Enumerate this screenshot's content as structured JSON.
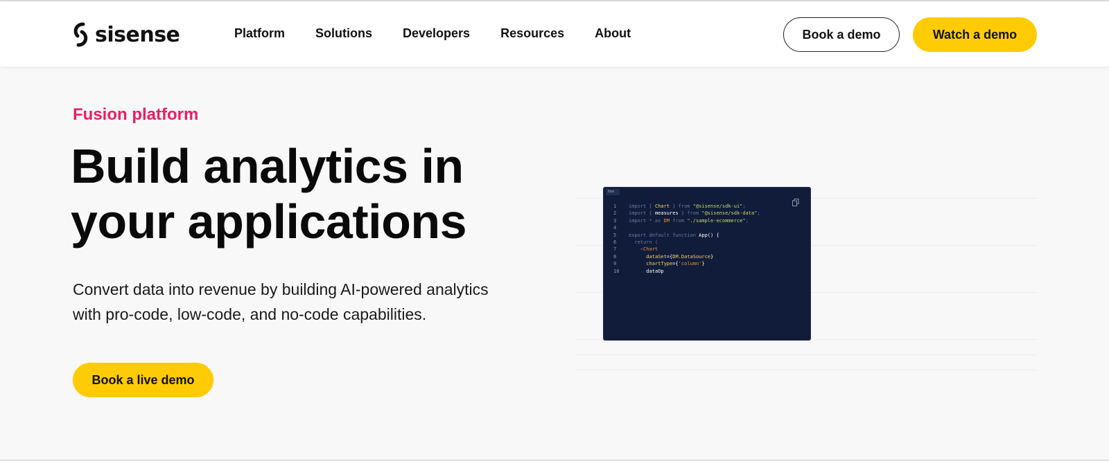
{
  "header": {
    "logo_text": "sisense",
    "nav": [
      "Platform",
      "Solutions",
      "Developers",
      "Resources",
      "About"
    ],
    "book_demo_label": "Book a demo",
    "watch_demo_label": "Watch a demo"
  },
  "hero": {
    "eyebrow": "Fusion platform",
    "title_line1": "Build analytics in",
    "title_line2": "your applications",
    "subtitle_line1": "Convert data into revenue by building AI-powered analytics",
    "subtitle_line2": "with pro-code, low-code, and no-code capabilities.",
    "cta_label": "Book a live demo"
  },
  "code_panel": {
    "tab_label": "tsx",
    "lines": [
      {
        "n": "1",
        "parts": [
          [
            "k",
            "import { "
          ],
          [
            "y",
            "Chart"
          ],
          [
            "k",
            " } from "
          ],
          [
            "g",
            "\"@sisense/sdk-ui\""
          ],
          [
            "k",
            ";"
          ]
        ]
      },
      {
        "n": "2",
        "parts": [
          [
            "k",
            "import { "
          ],
          [
            "w",
            "measures"
          ],
          [
            "k",
            " } from "
          ],
          [
            "g",
            "\"@sisense/sdk-data\""
          ],
          [
            "k",
            ";"
          ]
        ]
      },
      {
        "n": "3",
        "parts": [
          [
            "k",
            "import * as "
          ],
          [
            "o",
            "DM"
          ],
          [
            "k",
            " from "
          ],
          [
            "g",
            "\"./sample-ecommerce\""
          ],
          [
            "k",
            ";"
          ]
        ]
      },
      {
        "n": "4",
        "parts": [
          [
            "k",
            ""
          ]
        ]
      },
      {
        "n": "5",
        "parts": [
          [
            "k",
            "export default function "
          ],
          [
            "w",
            "App() {"
          ]
        ]
      },
      {
        "n": "6",
        "parts": [
          [
            "k",
            "  return ("
          ]
        ]
      },
      {
        "n": "7",
        "parts": [
          [
            "k",
            "    <"
          ],
          [
            "o",
            "Chart"
          ]
        ]
      },
      {
        "n": "8",
        "parts": [
          [
            "k",
            "      "
          ],
          [
            "y",
            "dataSet"
          ],
          [
            "w",
            "={"
          ],
          [
            "y",
            "DM.DataSource"
          ],
          [
            "w",
            "}"
          ]
        ]
      },
      {
        "n": "9",
        "parts": [
          [
            "k",
            "      "
          ],
          [
            "y",
            "chartType"
          ],
          [
            "w",
            "={"
          ],
          [
            "o",
            "'column'"
          ],
          [
            "w",
            "}"
          ]
        ]
      },
      {
        "n": "10",
        "parts": [
          [
            "k",
            "      "
          ],
          [
            "w",
            "dataOp"
          ]
        ]
      }
    ]
  },
  "colors": {
    "accent_yellow": "#ffcb05",
    "eyebrow_pink": "#e81f62",
    "code_bg": "#111c3a"
  }
}
